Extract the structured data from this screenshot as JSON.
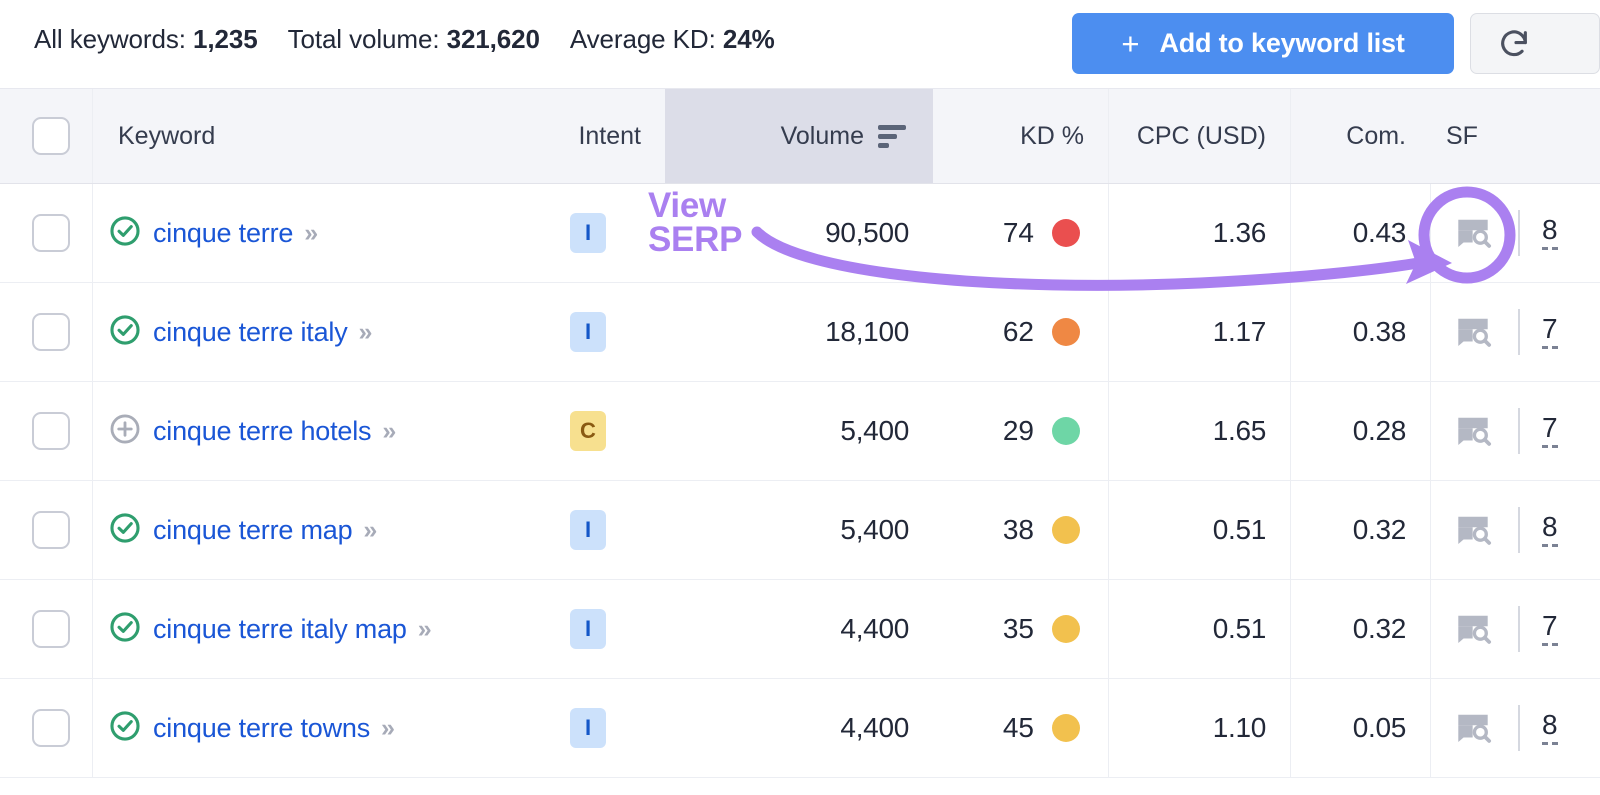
{
  "header": {
    "stats": [
      {
        "label": "All keywords:",
        "value": "1,235"
      },
      {
        "label": "Total volume:",
        "value": "321,620"
      },
      {
        "label": "Average KD:",
        "value": "24%"
      }
    ],
    "add_button": {
      "plus": "+",
      "label": "Add to keyword list"
    },
    "refresh_button_name": "refresh-icon",
    "accent_blue": "#4c8ef0"
  },
  "table": {
    "columns": {
      "keyword": "Keyword",
      "intent": "Intent",
      "volume": "Volume",
      "kd": "KD %",
      "cpc": "CPC (USD)",
      "com": "Com.",
      "sf": "SF"
    },
    "sorted_column": "volume",
    "sort_direction": "descending",
    "rows": [
      {
        "status_icon": "check-circle-icon",
        "keyword": "cinque terre",
        "intent": "I",
        "intent_type": "informational",
        "volume": "90,500",
        "kd": "74",
        "kd_color": "#ea4f4f",
        "cpc": "1.36",
        "com": "0.43",
        "sf": "8"
      },
      {
        "status_icon": "check-circle-icon",
        "keyword": "cinque terre italy",
        "intent": "I",
        "intent_type": "informational",
        "volume": "18,100",
        "kd": "62",
        "kd_color": "#ef8844",
        "cpc": "1.17",
        "com": "0.38",
        "sf": "7"
      },
      {
        "status_icon": "plus-circle-icon",
        "keyword": "cinque terre hotels",
        "intent": "C",
        "intent_type": "commercial",
        "volume": "5,400",
        "kd": "29",
        "kd_color": "#6ed6a6",
        "cpc": "1.65",
        "com": "0.28",
        "sf": "7"
      },
      {
        "status_icon": "check-circle-icon",
        "keyword": "cinque terre map",
        "intent": "I",
        "intent_type": "informational",
        "volume": "5,400",
        "kd": "38",
        "kd_color": "#f2c14e",
        "cpc": "0.51",
        "com": "0.32",
        "sf": "8"
      },
      {
        "status_icon": "check-circle-icon",
        "keyword": "cinque terre italy map",
        "intent": "I",
        "intent_type": "informational",
        "volume": "4,400",
        "kd": "35",
        "kd_color": "#f2c14e",
        "cpc": "0.51",
        "com": "0.32",
        "sf": "7"
      },
      {
        "status_icon": "check-circle-icon",
        "keyword": "cinque terre towns",
        "intent": "I",
        "intent_type": "informational",
        "volume": "4,400",
        "kd": "45",
        "kd_color": "#f2c14e",
        "cpc": "1.10",
        "com": "0.05",
        "sf": "8"
      }
    ]
  },
  "annotation": {
    "line1": "View",
    "line2": "SERP",
    "color": "#aa80f0",
    "target": "serp-preview-icon-row-1"
  }
}
